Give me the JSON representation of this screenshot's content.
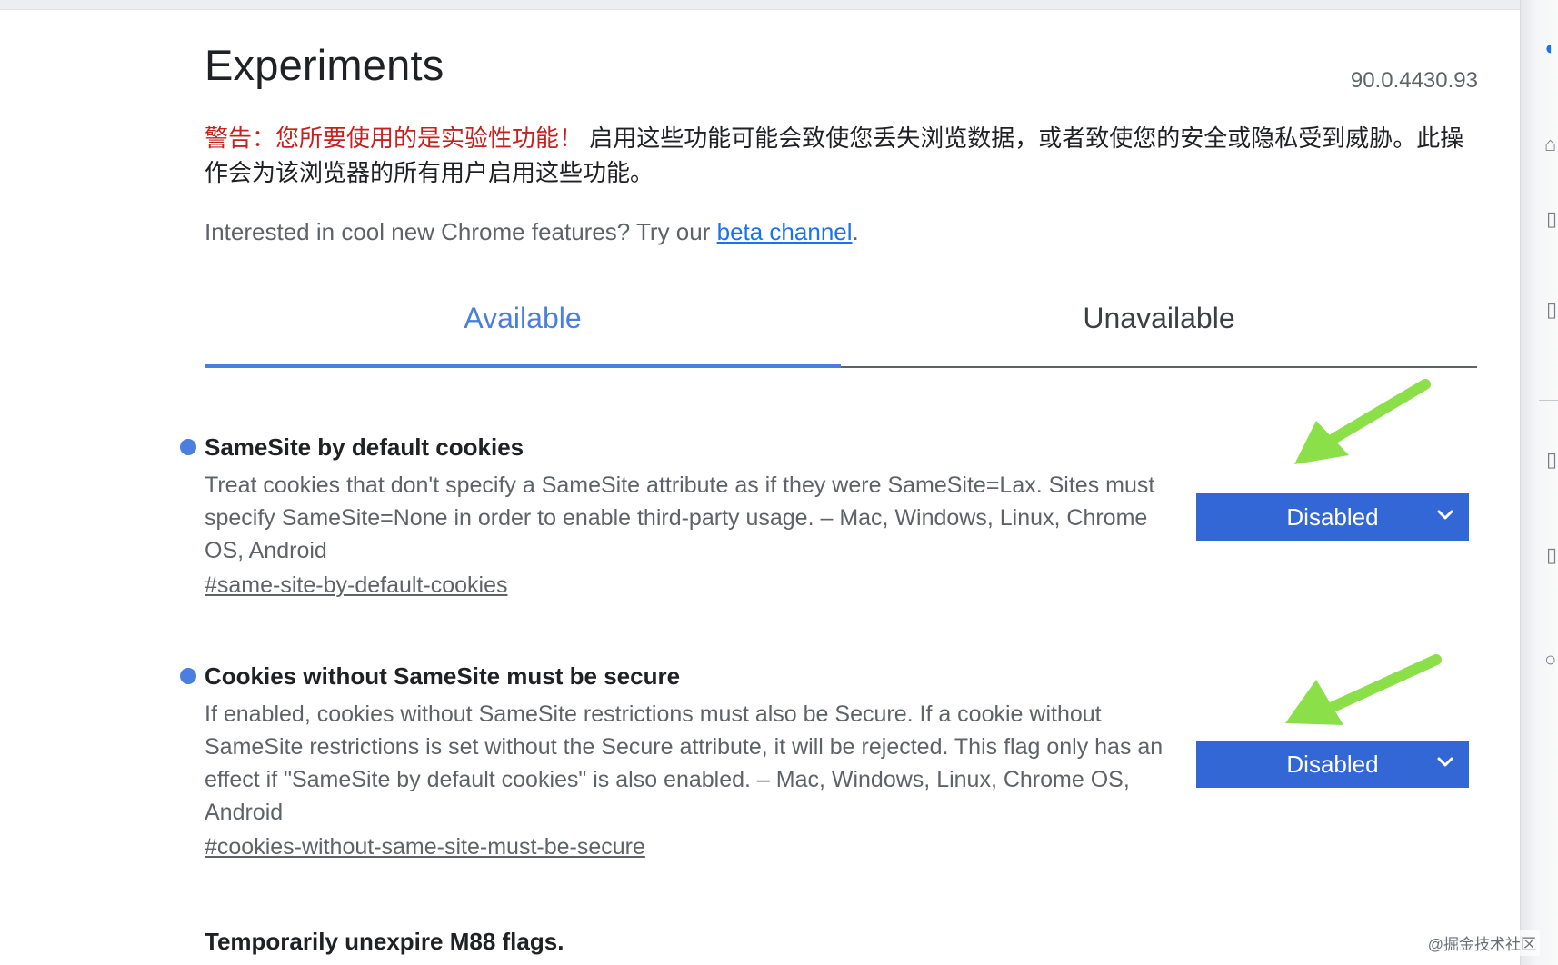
{
  "header": {
    "title": "Experiments",
    "version": "90.0.4430.93"
  },
  "warning": {
    "highlight": "警告：您所要使用的是实验性功能！",
    "text": " 启用这些功能可能会致使您丢失浏览数据，或者致使您的安全或隐私受到威胁。此操作会为该浏览器的所有用户启用这些功能。"
  },
  "promo": {
    "text": "Interested in cool new Chrome features? Try our ",
    "link": "beta channel",
    "suffix": "."
  },
  "tabs": [
    {
      "label": "Available",
      "active": true
    },
    {
      "label": "Unavailable",
      "active": false
    }
  ],
  "flags": [
    {
      "title": "SameSite by default cookies",
      "description": "Treat cookies that don't specify a SameSite attribute as if they were SameSite=Lax. Sites must specify SameSite=None in order to enable third-party usage. – Mac, Windows, Linux, Chrome OS, Android",
      "link": "#same-site-by-default-cookies",
      "selected": "Disabled"
    },
    {
      "title": "Cookies without SameSite must be secure",
      "description": "If enabled, cookies without SameSite restrictions must also be Secure. If a cookie without SameSite restrictions is set without the Secure attribute, it will be rejected. This flag only has an effect if \"SameSite by default cookies\" is also enabled. – Mac, Windows, Linux, Chrome OS, Android",
      "link": "#cookies-without-same-site-must-be-secure",
      "selected": "Disabled"
    },
    {
      "title": "Temporarily unexpire M88 flags."
    }
  ],
  "watermark": "@掘金技术社区",
  "colors": {
    "accent": "#4a7fe0",
    "select_bg": "#3367d6",
    "warning": "#c5221f",
    "annotation_arrow": "#8be04a"
  },
  "icons": {
    "chevron": "chevron-down-icon",
    "flag_marker": "blue-dot-icon",
    "annotation": "green-arrow-icon"
  }
}
